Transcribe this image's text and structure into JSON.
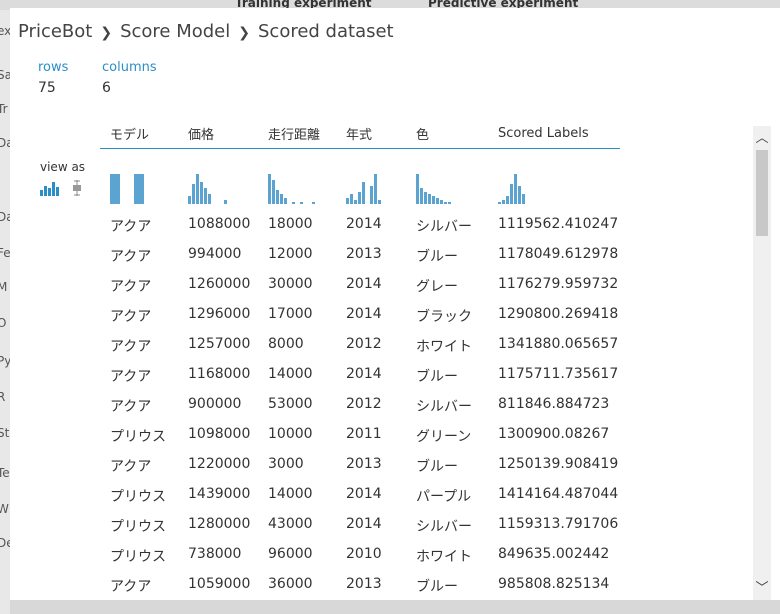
{
  "background": {
    "tabs": [
      "Training experiment",
      "Predictive experiment"
    ],
    "sidebar_letters": [
      "ex",
      "Sa",
      "Tr",
      "Da",
      "Da",
      "Fe",
      "M",
      "O",
      "Py",
      "R",
      "St",
      "Te",
      "W",
      "De"
    ]
  },
  "breadcrumb": {
    "items": [
      "PriceBot",
      "Score Model",
      "Scored dataset"
    ]
  },
  "stats": {
    "rows_label": "rows",
    "rows_value": "75",
    "columns_label": "columns",
    "columns_value": "6"
  },
  "view_as": {
    "label": "view as"
  },
  "table": {
    "columns": [
      "モデル",
      "価格",
      "走行距離",
      "年式",
      "色",
      "Scored Labels"
    ],
    "rows": [
      [
        "アクア",
        "1088000",
        "18000",
        "2014",
        "シルバー",
        "1119562.410247"
      ],
      [
        "アクア",
        "994000",
        "12000",
        "2013",
        "ブルー",
        "1178049.612978"
      ],
      [
        "アクア",
        "1260000",
        "30000",
        "2014",
        "グレー",
        "1176279.959732"
      ],
      [
        "アクア",
        "1296000",
        "17000",
        "2014",
        "ブラック",
        "1290800.269418"
      ],
      [
        "アクア",
        "1257000",
        "8000",
        "2012",
        "ホワイト",
        "1341880.065657"
      ],
      [
        "アクア",
        "1168000",
        "14000",
        "2014",
        "ブルー",
        "1175711.735617"
      ],
      [
        "アクア",
        "900000",
        "53000",
        "2012",
        "シルバー",
        "811846.884723"
      ],
      [
        "プリウス",
        "1098000",
        "10000",
        "2011",
        "グリーン",
        "1300900.08267"
      ],
      [
        "アクア",
        "1220000",
        "3000",
        "2013",
        "ブルー",
        "1250139.908419"
      ],
      [
        "プリウス",
        "1439000",
        "14000",
        "2014",
        "パープル",
        "1414164.487044"
      ],
      [
        "プリウス",
        "1280000",
        "43000",
        "2014",
        "シルバー",
        "1159313.791706"
      ],
      [
        "プリウス",
        "738000",
        "96000",
        "2010",
        "ホワイト",
        "849635.002442"
      ],
      [
        "アクア",
        "1059000",
        "36000",
        "2013",
        "ブルー",
        "985808.825134"
      ]
    ]
  },
  "colors": {
    "accent": "#2b8fc7",
    "histogram": "#5ba3d0"
  }
}
